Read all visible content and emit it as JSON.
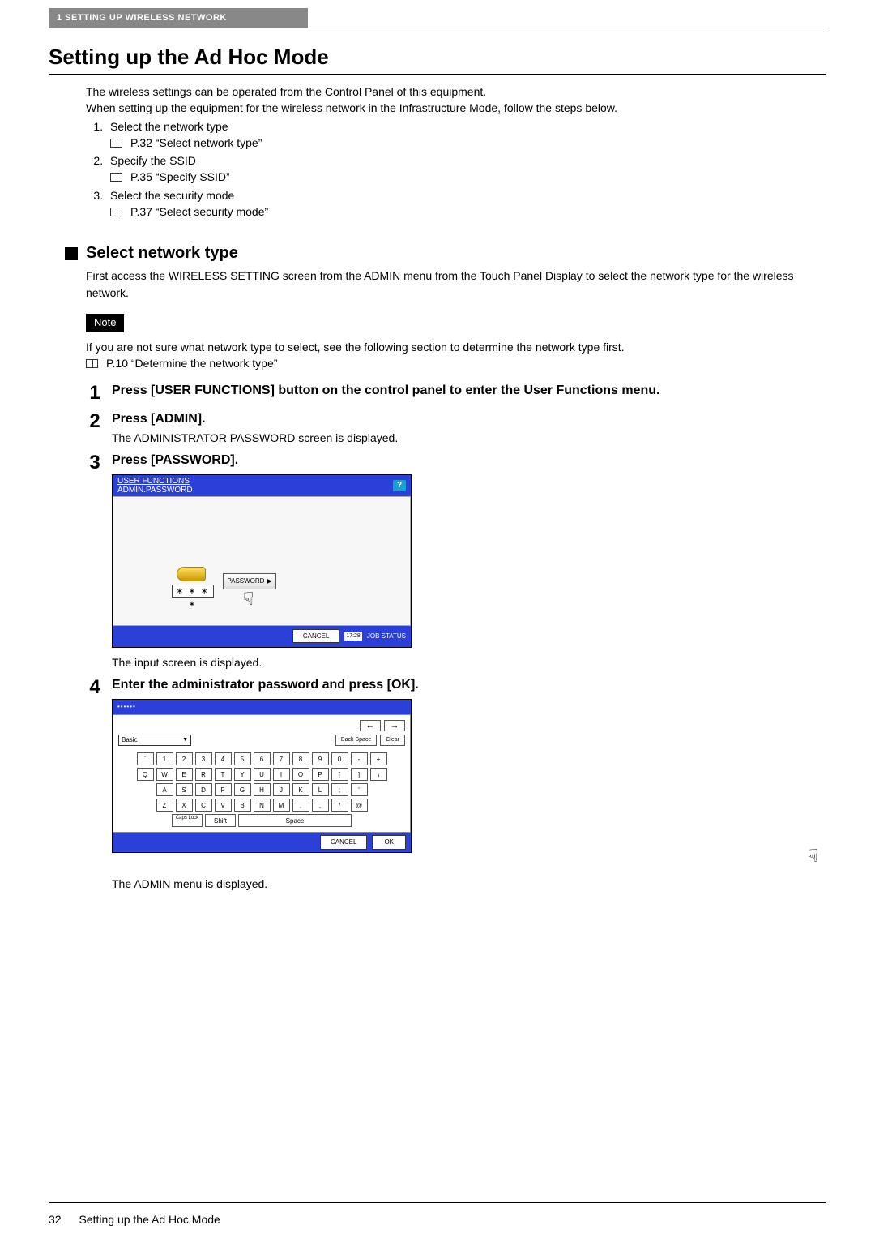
{
  "header": {
    "chapter_label": "1 SETTING UP WIRELESS NETWORK"
  },
  "title": "Setting up the Ad Hoc Mode",
  "intro": {
    "p1": "The wireless settings can be operated from the Control Panel of this equipment.",
    "p2": "When setting up the equipment for the wireless network in the Infrastructure Mode, follow the steps below.",
    "items": [
      {
        "text": "Select the network type",
        "ref": "P.32 “Select network type”"
      },
      {
        "text": "Specify the SSID",
        "ref": "P.35 “Specify SSID”"
      },
      {
        "text": "Select the security mode",
        "ref": "P.37 “Select security mode”"
      }
    ]
  },
  "section": {
    "heading": "Select network type",
    "body": "First access the WIRELESS SETTING screen from the ADMIN menu from the Touch Panel Display to select the network type for the wireless network.",
    "note_label": "Note",
    "note_text": "If you are not sure what network type to select, see the following section to determine the network type first.",
    "note_ref": "P.10 “Determine the network type”"
  },
  "steps": [
    {
      "num": "1",
      "heading": "Press [USER FUNCTIONS] button on the control panel to enter the User Functions menu."
    },
    {
      "num": "2",
      "heading": "Press [ADMIN].",
      "body": "The ADMINISTRATOR PASSWORD screen is displayed."
    },
    {
      "num": "3",
      "heading": "Press [PASSWORD].",
      "caption": "The input screen is displayed."
    },
    {
      "num": "4",
      "heading": "Enter the administrator password and press [OK].",
      "caption": "The ADMIN menu is displayed."
    }
  ],
  "figure_password": {
    "title_line1": "USER FUNCTIONS",
    "title_line2": "ADMIN.PASSWORD",
    "help": "?",
    "masked": "∗ ∗ ∗ ∗",
    "password_btn": "PASSWORD",
    "cancel": "CANCEL",
    "job_status": "JOB STATUS",
    "time": "17:28"
  },
  "figure_keyboard": {
    "dots": "••••••",
    "nav_left": "←",
    "nav_right": "→",
    "mode": "Basic",
    "backspace": "Back Space",
    "clear": "Clear",
    "rows": {
      "r1": [
        "`",
        "1",
        "2",
        "3",
        "4",
        "5",
        "6",
        "7",
        "8",
        "9",
        "0",
        "-",
        "+"
      ],
      "r2": [
        "Q",
        "W",
        "E",
        "R",
        "T",
        "Y",
        "U",
        "I",
        "O",
        "P",
        "[",
        "]",
        "\\"
      ],
      "r3": [
        "A",
        "S",
        "D",
        "F",
        "G",
        "H",
        "J",
        "K",
        "L",
        ";",
        "'"
      ],
      "r4": [
        "Z",
        "X",
        "C",
        "V",
        "B",
        "N",
        "M",
        ",",
        ".",
        "/",
        "@"
      ]
    },
    "caps": "Caps Lock",
    "shift": "Shift",
    "space": "Space",
    "cancel": "CANCEL",
    "ok": "OK"
  },
  "footer": {
    "page": "32",
    "label": "Setting up the Ad Hoc Mode"
  }
}
